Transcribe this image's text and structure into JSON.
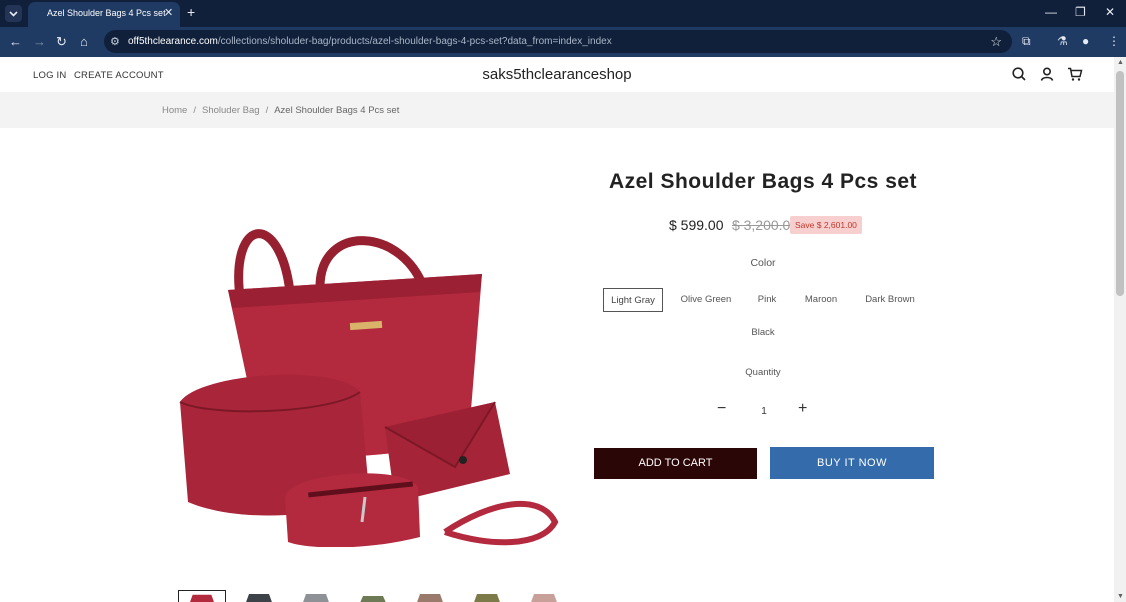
{
  "browser": {
    "tab_title": "Azel Shoulder Bags 4 Pcs set",
    "url_host": "off5thclearance.com",
    "url_path": "/collections/sholuder-bag/products/azel-shoulder-bags-4-pcs-set?data_from=index_index"
  },
  "header": {
    "login": "LOG IN",
    "create_account": "CREATE ACCOUNT",
    "brand": "saks5thclearanceshop"
  },
  "breadcrumb": {
    "home": "Home",
    "category": "Sholuder Bag",
    "current": "Azel Shoulder Bags 4 Pcs set",
    "separator": "/"
  },
  "product": {
    "title": "Azel Shoulder Bags 4 Pcs set",
    "price": "$ 599.00",
    "compare_price": "$ 3,200.00",
    "save_badge": "Save $ 2,601.00",
    "color_label": "Color",
    "colors": [
      "Light Gray",
      "Olive Green",
      "Pink",
      "Maroon",
      "Dark Brown",
      "Black"
    ],
    "selected_color": "Light Gray",
    "quantity_label": "Quantity",
    "quantity": "1",
    "add_to_cart": "ADD TO CART",
    "buy_now": "BUY IT NOW"
  },
  "colors": {
    "bag_red": "#b0293e",
    "cart_button": "#2b0606",
    "buy_button": "#346cab",
    "badge_bg": "#f7cfcf",
    "badge_text": "#c0392b"
  }
}
